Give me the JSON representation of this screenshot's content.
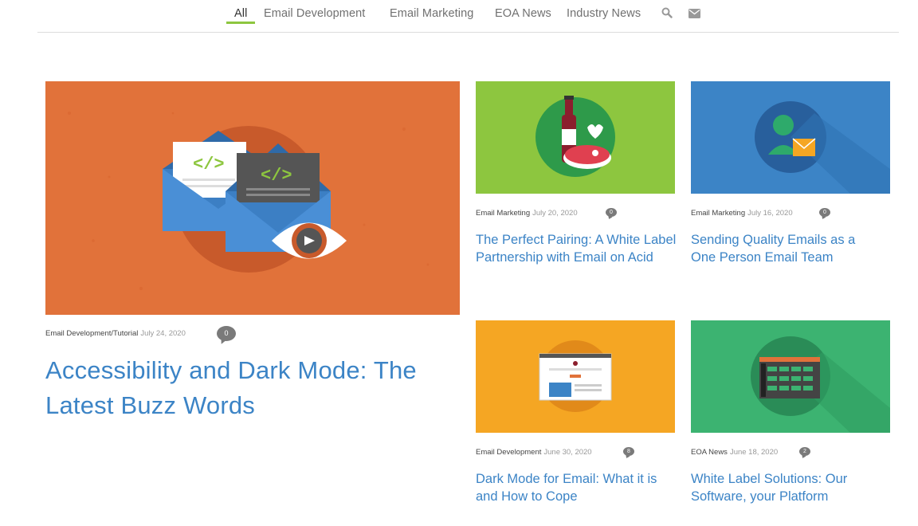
{
  "nav": {
    "items": [
      "All",
      "Email Development",
      "Email Marketing",
      "EOA News",
      "Industry News"
    ],
    "active": "All",
    "search_icon": "search-icon",
    "mail_icon": "mail-icon",
    "accent": "#8dc63f"
  },
  "posts": [
    {
      "category": "Email Development/Tutorial",
      "date": "July 24, 2020",
      "comments": "0",
      "title": "Accessibility and Dark Mode: The Latest Buzz Words",
      "bg": "#e1723a"
    },
    {
      "category": "Email Marketing",
      "date": "July 20, 2020",
      "comments": "0",
      "title": "The Perfect Pairing: A White Label Partnership with Email on Acid",
      "bg": "#8dc63f"
    },
    {
      "category": "Email Marketing",
      "date": "July 16, 2020",
      "comments": "0",
      "title": "Sending Quality Emails as a One Person Email Team",
      "bg": "#3c84c6"
    },
    {
      "category": "Email Development",
      "date": "June 30, 2020",
      "comments": "8",
      "title": "Dark Mode for Email: What it is and How to Cope",
      "bg": "#f5a623"
    },
    {
      "category": "EOA News",
      "date": "June 18, 2020",
      "comments": "2",
      "title": "White Label Solutions: Our Software, your Platform",
      "bg": "#3cb371"
    }
  ]
}
